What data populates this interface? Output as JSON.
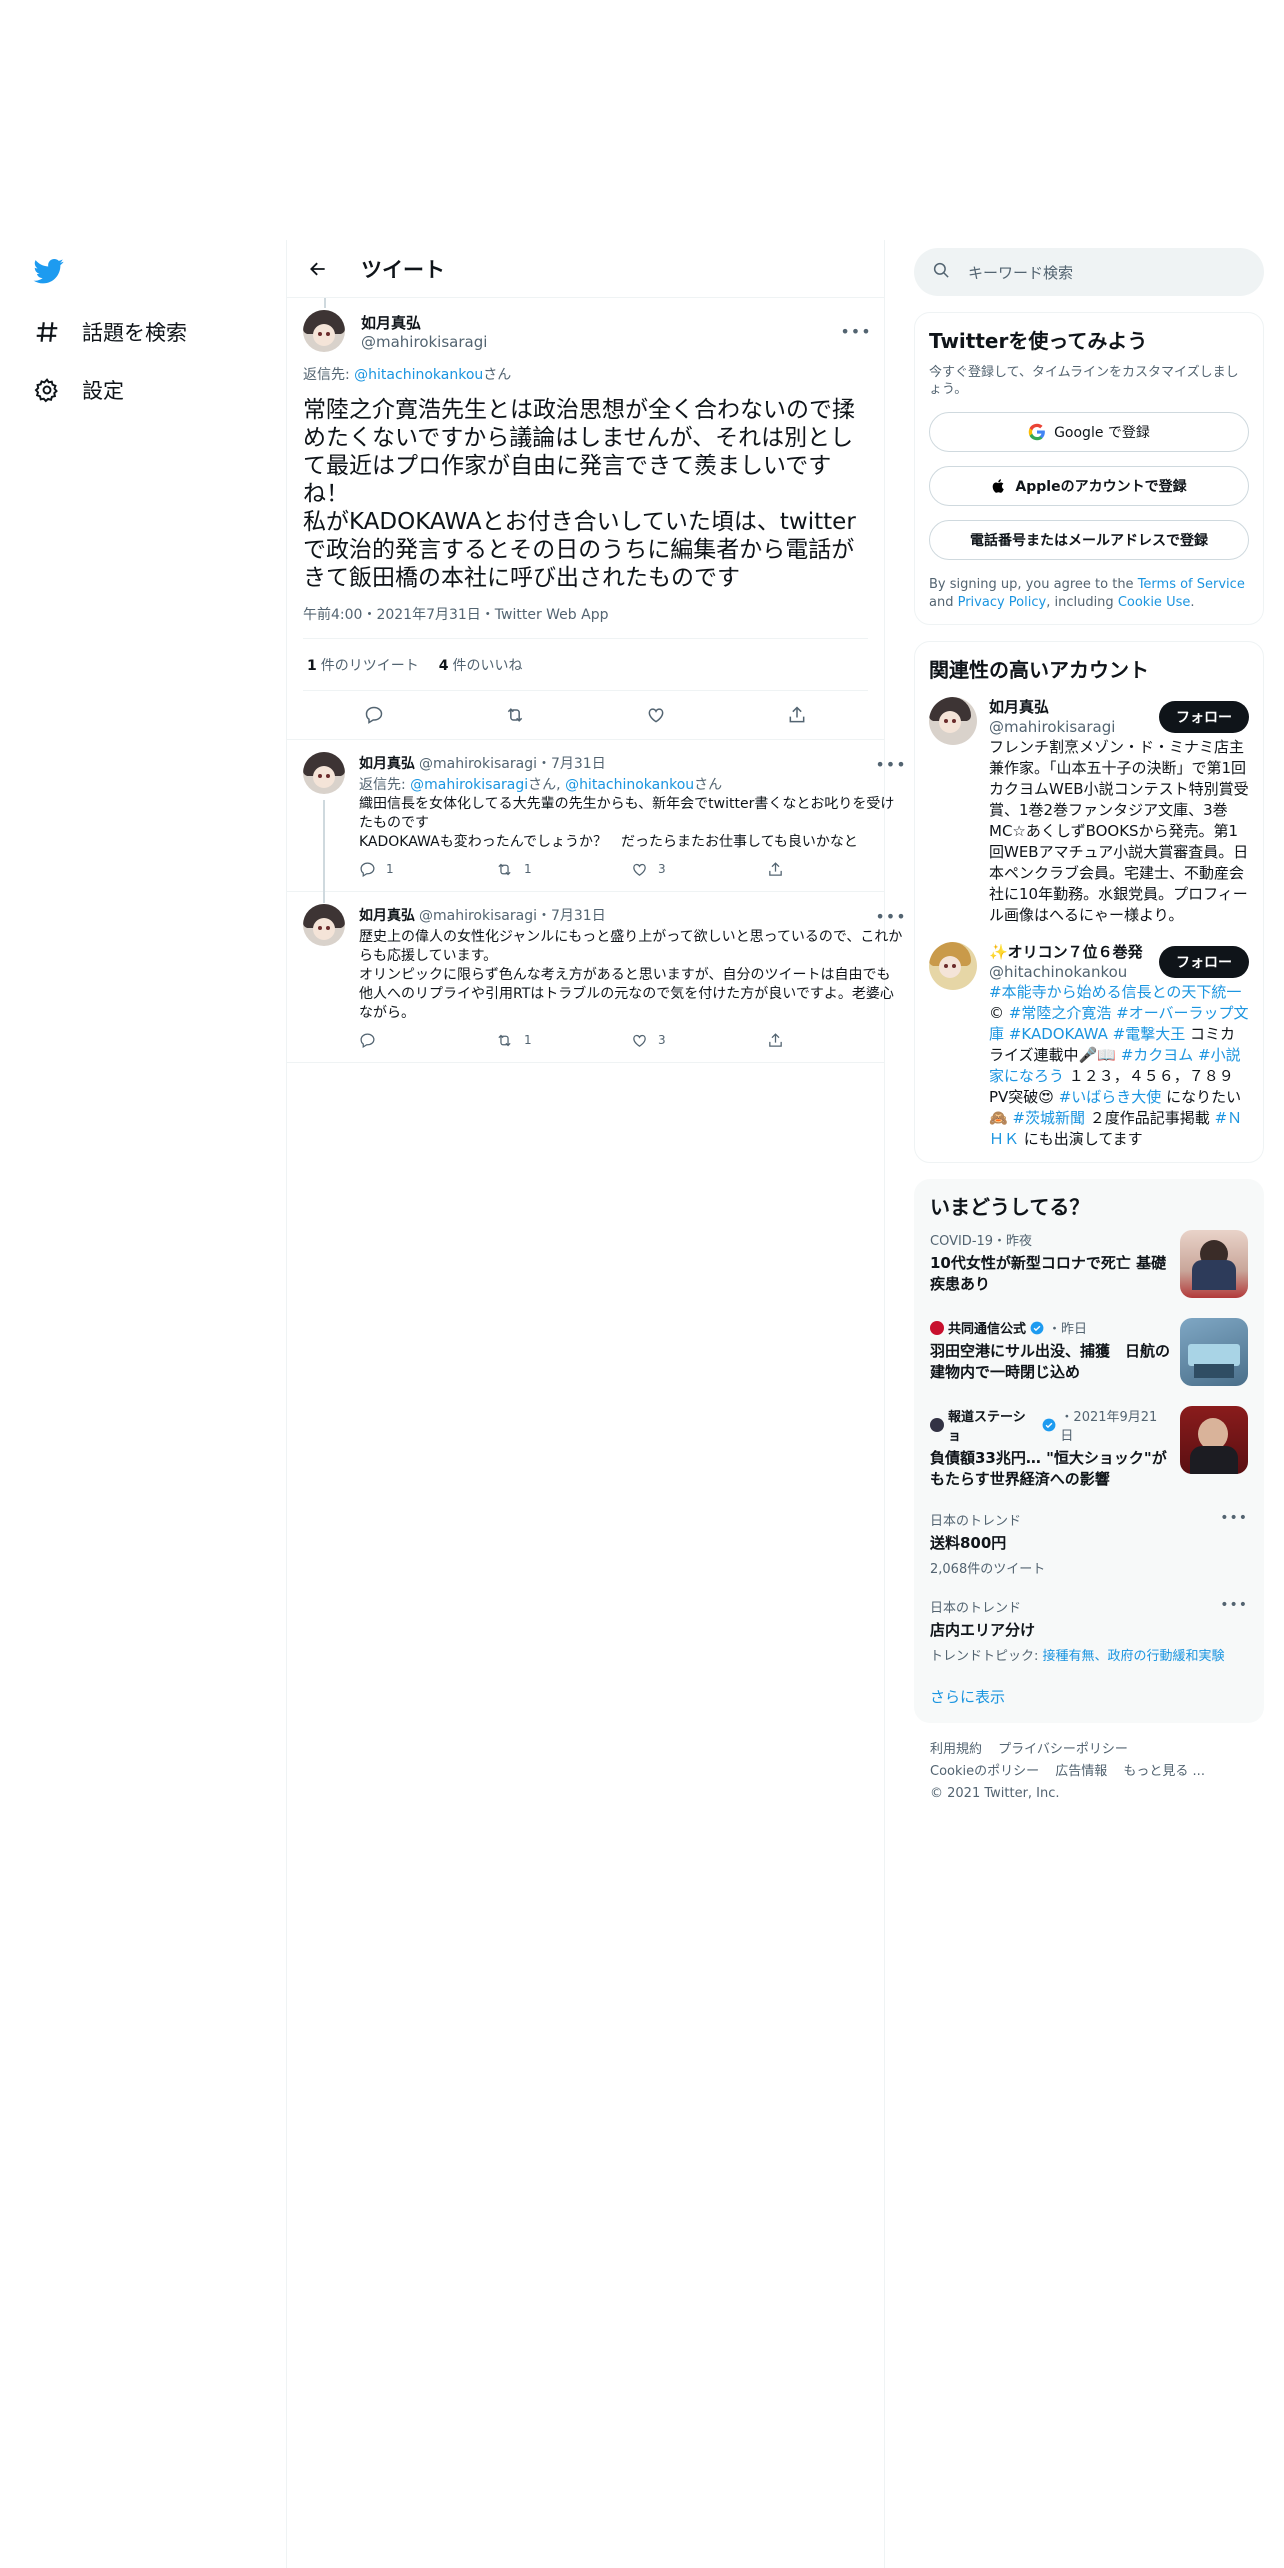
{
  "nav": {
    "items": [
      {
        "label": "話題を検索",
        "icon": "hash-icon"
      },
      {
        "label": "設定",
        "icon": "gear-icon"
      }
    ]
  },
  "header": {
    "title": "ツイート"
  },
  "focal": {
    "name": "如月真弘",
    "handle": "@mahirokisaragi",
    "reply_prefix": "返信先: ",
    "reply_to": "@hitachinokankou",
    "reply_suffix": "さん",
    "text": "常陸之介寛浩先生とは政治思想が全く合わないので揉めたくないですから議論はしませんが、それは別として最近はプロ作家が自由に発言できて羨ましいですね！\n私がKADOKAWAとお付き合いしていた頃は、twitterで政治的発言するとその日のうちに編集者から電話がきて飯田橋の本社に呼び出されたものです",
    "meta": "午前4:00・2021年7月31日・Twitter Web App",
    "retweets_count": "1",
    "retweets_label": "件のリツイート",
    "likes_count": "4",
    "likes_label": "件のいいね"
  },
  "replies": [
    {
      "name": "如月真弘",
      "handle": "@mahirokisaragi",
      "date": "・7月31日",
      "reply_prefix": "返信先: ",
      "reply_to_1": "@mahirokisaragi",
      "reply_mid": "さん, ",
      "reply_to_2": "@hitachinokankou",
      "reply_suffix": "さん",
      "text": "織田信長を女体化してる大先輩の先生からも、新年会でtwitter書くなとお叱りを受けたものです\nKADOKAWAも変わったんでしょうか？　だったらまたお仕事しても良いかなと",
      "replies": "1",
      "retweets": "1",
      "likes": "3"
    },
    {
      "name": "如月真弘",
      "handle": "@mahirokisaragi",
      "date": "・7月31日",
      "text": "歴史上の偉人の女性化ジャンルにもっと盛り上がって欲しいと思っているので、これからも応援しています。\nオリンピックに限らず色んな考え方があると思いますが、自分のツイートは自由でも他人へのリプライや引用RTはトラブルの元なので気を付けた方が良いですよ。老婆心ながら。",
      "replies": "",
      "retweets": "1",
      "likes": "3"
    }
  ],
  "search": {
    "placeholder": "キーワード検索"
  },
  "signup": {
    "title": "Twitterを使ってみよう",
    "sub": "今すぐ登録して、タイムラインをカスタマイズしましょう。",
    "google": "Google で登録",
    "apple": "Appleのアカウントで登録",
    "phone": "電話番号またはメールアドレスで登録",
    "terms_1": "By signing up, you agree to the ",
    "terms_tos": "Terms of Service",
    "terms_2": " and ",
    "terms_pp": "Privacy Policy",
    "terms_3": ", including ",
    "terms_cookie": "Cookie Use",
    "terms_4": "."
  },
  "related": {
    "title": "関連性の高いアカウント",
    "follow_label": "フォロー",
    "accounts": [
      {
        "name": "如月真弘",
        "handle": "@mahirokisaragi",
        "bio": "フレンチ割烹メゾン・ド・ミナミ店主兼作家。「山本五十子の決断」で第1回カクヨムWEB小説コンテスト特別賞受賞、1巻2巻ファンタジア文庫、3巻MC☆あくしずBOOKSから発売。第1回WEBアマチュア小説大賞審査員。日本ペンクラブ会員。宅建士、不動産会社に10年勤務。水銀党員。プロフィール画像はへるにゃー様より。"
      },
      {
        "name": "✨オリコン７位６巻発",
        "handle": "@hitachinokankou",
        "bio_link1": "#本能寺から始める信長との天下統一",
        "bio_t1": " ©︎ ",
        "bio_link2": "#常陸之介寛浩",
        "bio_t2": " ",
        "bio_link3": "#オーバーラップ文庫",
        "bio_t3": " ",
        "bio_link4": "#KADOKAWA",
        "bio_t4": " ",
        "bio_link5": "#電撃大王",
        "bio_t5": " コミカライズ連載中🎤📖 ",
        "bio_link6": "#カクヨム",
        "bio_t6": " ",
        "bio_link7": "#小説家になろう",
        "bio_t7": " １２３，４５６，７８９PV突破😍 ",
        "bio_link8": "#いばらき大使",
        "bio_t8": " になりたい🙈 ",
        "bio_link9": "#茨城新聞",
        "bio_t9": " ２度作品記事掲載 ",
        "bio_link10": "#ＮＨＫ",
        "bio_t10": " にも出演してます"
      }
    ]
  },
  "trends": {
    "title": "いまどうしてる？",
    "items": [
      {
        "category": "COVID-19・昨夜",
        "title": "10代女性が新型コロナで死亡 基礎疾患あり"
      },
      {
        "category": "共同通信公式",
        "category_suffix": "・昨日",
        "title": "羽田空港にサル出没、捕獲　日航の建物内で一時閉じ込め"
      },
      {
        "category": "報道ステーショ",
        "category_suffix": "・2021年9月21日",
        "title": "負債額33兆円… \"恒大ショック\"がもたらす世界経済への影響"
      },
      {
        "category": "日本のトレンド",
        "title": "送料800円",
        "count": "2,068件のツイート"
      },
      {
        "category": "日本のトレンド",
        "title": "店内エリア分け",
        "topic_prefix": "トレンドトピック: ",
        "topic": "接種有無、政府の行動緩和実験"
      }
    ],
    "show_more": "さらに表示"
  },
  "footer": {
    "links_row1": [
      "利用規約",
      "プライバシーポリシー"
    ],
    "links_row2": [
      "Cookieのポリシー",
      "広告情報",
      "もっと見る ..."
    ],
    "copyright": "© 2021 Twitter, Inc."
  },
  "colors": {
    "accent": "#1b95e0",
    "twitter_blue": "#1d9bf0",
    "text": "#0f1419",
    "muted": "#536471"
  }
}
